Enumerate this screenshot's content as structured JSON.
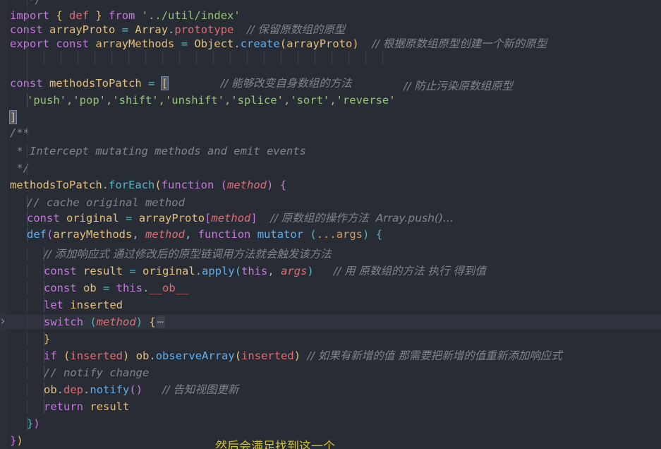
{
  "editor": {
    "theme_background": "#282c34",
    "foreground": "#abb2bf",
    "comment_color": "#7f848e",
    "annotation_color": "#d6c433",
    "fold_chevron": "›"
  },
  "lines": {
    "l01_tail": "*/",
    "l02_import": "import",
    "l02_brace_open": "{",
    "l02_def": "def",
    "l02_brace_close": "}",
    "l02_from": "from",
    "l02_path": "'../util/index'",
    "l03_const": "const",
    "l03_name": "arrayProto",
    "l03_eq": "=",
    "l03_array": "Array",
    "l03_dot": ".",
    "l03_proto": "prototype",
    "l03_comment": "// 保留原数组的原型",
    "l04_export": "export",
    "l04_const": "const",
    "l04_name": "arrayMethods",
    "l04_eq": "=",
    "l04_object": "Object",
    "l04_dot": ".",
    "l04_create": "create",
    "l04_paren_open": "(",
    "l04_arg": "arrayProto",
    "l04_paren_close": ")",
    "l04_comment": "// 根据原数组原型创建一个新的原型",
    "l05_comment": "// 防止污染原数组原型",
    "l07_const": "const",
    "l07_name": "methodsToPatch",
    "l07_eq": "=",
    "l07_bracket_open": "[",
    "l07_comment": "// 能够改变自身数组的方法",
    "l08_strings": "'push','pop','shift','unshift','splice','sort','reverse'",
    "l09_bracket_close": "]",
    "l10_blockstart": "/**",
    "l11_blockmid": " * Intercept mutating methods and emit events",
    "l12_blockend": " */",
    "l13_obj": "methodsToPatch",
    "l13_dot": ".",
    "l13_foreach": "forEach",
    "l13_paren_open": "(",
    "l13_function": "function",
    "l13_paren2_open": "(",
    "l13_param": "method",
    "l13_paren2_close": ")",
    "l13_brace_open": "{",
    "l14_comment": "// cache original method",
    "l15_const": "const",
    "l15_name": "original",
    "l15_eq": "=",
    "l15_obj": "arrayProto",
    "l15_bracket_open": "[",
    "l15_key": "method",
    "l15_bracket_close": "]",
    "l15_comment": "// 原数组的操作方法  Array.push()...",
    "l16_def": "def",
    "l16_paren_open": "(",
    "l16_arg1": "arrayMethods",
    "l16_comma1": ",",
    "l16_arg2": "method",
    "l16_comma2": ",",
    "l16_function": "function",
    "l16_fname": "mutator",
    "l16_paren2_open": "(",
    "l16_rest": "...args",
    "l16_paren2_close": ")",
    "l16_brace_open": "{",
    "l17_comment": "// 添加响应式 通过修改后的原型链调用方法就会触发该方法",
    "l18_const": "const",
    "l18_name": "result",
    "l18_eq": "=",
    "l18_obj": "original",
    "l18_dot": ".",
    "l18_apply": "apply",
    "l18_paren_open": "(",
    "l18_this": "this",
    "l18_comma": ",",
    "l18_args": "args",
    "l18_paren_close": ")",
    "l18_comment": "// 用 原数组的方法 执行 得到值",
    "l19_const": "const",
    "l19_name": "ob",
    "l19_eq": "=",
    "l19_this": "this",
    "l19_dot": ".",
    "l19_ob": "__ob__",
    "l20_let": "let",
    "l20_name": "inserted",
    "l21_switch": "switch",
    "l21_paren_open": "(",
    "l21_param": "method",
    "l21_paren_close": ")",
    "l21_brace_open": "{",
    "l21_fold": "⋯",
    "l22_brace_close": "}",
    "l23_if": "if",
    "l23_paren_open": "(",
    "l23_cond": "inserted",
    "l23_paren_close": ")",
    "l23_obj": "ob",
    "l23_dot": ".",
    "l23_method": "observeArray",
    "l23_paren2_open": "(",
    "l23_arg": "inserted",
    "l23_paren2_close": ")",
    "l23_comment": "// 如果有新增的值 那需要把新增的值重新添加响应式",
    "l24_comment": "// notify change",
    "l25_obj": "ob",
    "l25_dot1": ".",
    "l25_dep": "dep",
    "l25_dot2": ".",
    "l25_notify": "notify",
    "l25_paren_open": "(",
    "l25_paren_close": ")",
    "l25_comment": "// 告知视图更新",
    "l26_return": "return",
    "l26_name": "result",
    "l27_brace_close": "}",
    "l27_paren_close": ")",
    "l28_brace_close": "}",
    "l28_paren_close": ")"
  },
  "annotation": {
    "text": "然后会满足找到这一个"
  }
}
